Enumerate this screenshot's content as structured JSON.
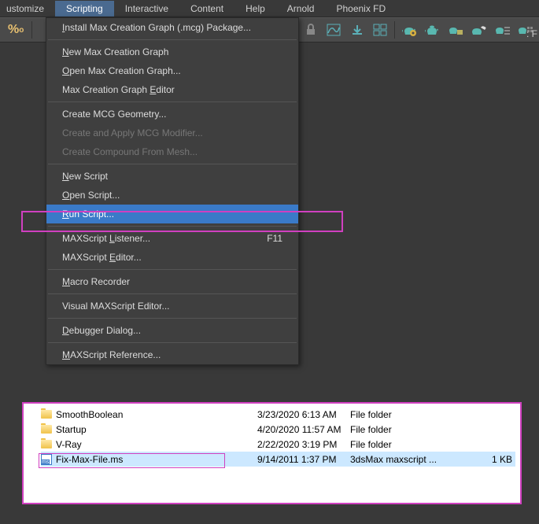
{
  "menubar": {
    "items": [
      {
        "label": "ustomize"
      },
      {
        "label": "Scripting"
      },
      {
        "label": "Interactive"
      },
      {
        "label": "Content"
      },
      {
        "label": "Help"
      },
      {
        "label": "Arnold"
      },
      {
        "label": "Phoenix FD"
      }
    ]
  },
  "dropdown": {
    "groups": [
      [
        {
          "label": "Install Max Creation Graph (.mcg) Package...",
          "enabled": true,
          "mnemonic": "I"
        }
      ],
      [
        {
          "label": "New Max Creation Graph",
          "enabled": true,
          "mnemonic": "N"
        },
        {
          "label": "Open Max Creation Graph...",
          "enabled": true,
          "mnemonic": "O"
        },
        {
          "label": "Max Creation Graph Editor",
          "enabled": true,
          "mnemonic": "E"
        }
      ],
      [
        {
          "label": "Create MCG Geometry...",
          "enabled": true
        },
        {
          "label": "Create and Apply MCG Modifier...",
          "enabled": false
        },
        {
          "label": "Create Compound From Mesh...",
          "enabled": false
        }
      ],
      [
        {
          "label": "New Script",
          "enabled": true,
          "mnemonic": "N"
        },
        {
          "label": "Open Script...",
          "enabled": true,
          "mnemonic": "O"
        },
        {
          "label": "Run Script...",
          "enabled": true,
          "mnemonic": "R",
          "highlighted": true
        }
      ],
      [
        {
          "label": "MAXScript Listener...",
          "enabled": true,
          "mnemonic": "L",
          "shortcut": "F11"
        },
        {
          "label": "MAXScript Editor...",
          "enabled": true,
          "mnemonic": "E"
        }
      ],
      [
        {
          "label": "Macro Recorder",
          "enabled": true,
          "mnemonic": "M"
        }
      ],
      [
        {
          "label": "Visual MAXScript Editor...",
          "enabled": true
        }
      ],
      [
        {
          "label": "Debugger Dialog...",
          "enabled": true,
          "mnemonic": "D"
        }
      ],
      [
        {
          "label": "MAXScript Reference...",
          "enabled": true,
          "mnemonic": "M"
        }
      ]
    ]
  },
  "files": {
    "rows": [
      {
        "name": "SmoothBoolean",
        "date": "3/23/2020 6:13 AM",
        "type": "File folder",
        "size": "",
        "kind": "folder"
      },
      {
        "name": "Startup",
        "date": "4/20/2020 11:57 AM",
        "type": "File folder",
        "size": "",
        "kind": "folder"
      },
      {
        "name": "V-Ray",
        "date": "2/22/2020 3:19 PM",
        "type": "File folder",
        "size": "",
        "kind": "folder"
      },
      {
        "name": "Fix-Max-File.ms",
        "date": "9/14/2011 1:37 PM",
        "type": "3dsMax maxscript ...",
        "size": "1 KB",
        "kind": "ms",
        "selected": true
      }
    ]
  },
  "toolbar_right_text": ": F"
}
